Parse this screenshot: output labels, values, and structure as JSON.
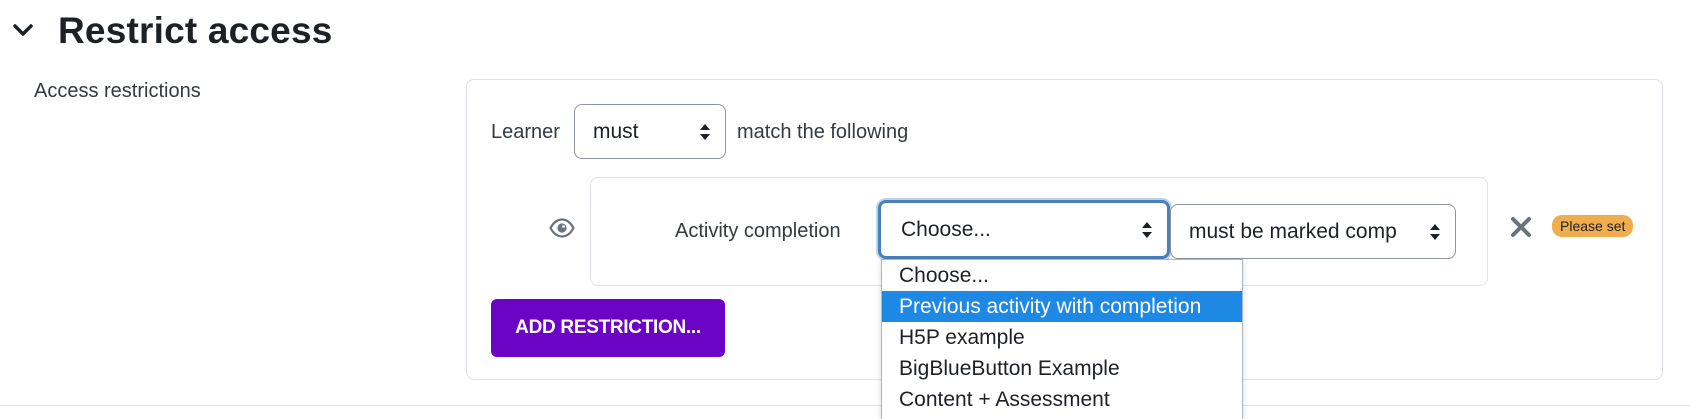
{
  "section": {
    "title": "Restrict access",
    "toggle_icon": "chevron-down-icon"
  },
  "field": {
    "label": "Access restrictions"
  },
  "condition_set": {
    "prefix": "Learner",
    "operator_select": {
      "value": "must",
      "options_visible": [
        "must"
      ]
    },
    "suffix": "match the following"
  },
  "restriction": {
    "visibility_icon": "eye-icon",
    "type_label": "Activity completion",
    "activity_select": {
      "value": "Choose..."
    },
    "state_select": {
      "value": "must be marked comp"
    },
    "delete_icon": "close-icon",
    "badge": "Please set"
  },
  "add_button": {
    "label": "ADD RESTRICTION..."
  },
  "dropdown": {
    "options": [
      {
        "label": "Choose...",
        "highlighted": false
      },
      {
        "label": "Previous activity with completion",
        "highlighted": true
      },
      {
        "label": "H5P example",
        "highlighted": false
      },
      {
        "label": "BigBlueButton Example",
        "highlighted": false
      },
      {
        "label": "Content + Assessment",
        "highlighted": false
      }
    ]
  },
  "colors": {
    "primary_button": "#6b04c4",
    "focus_border": "#4a80b9",
    "highlight": "#1e88e5",
    "badge_warning": "#f0ad4e"
  }
}
